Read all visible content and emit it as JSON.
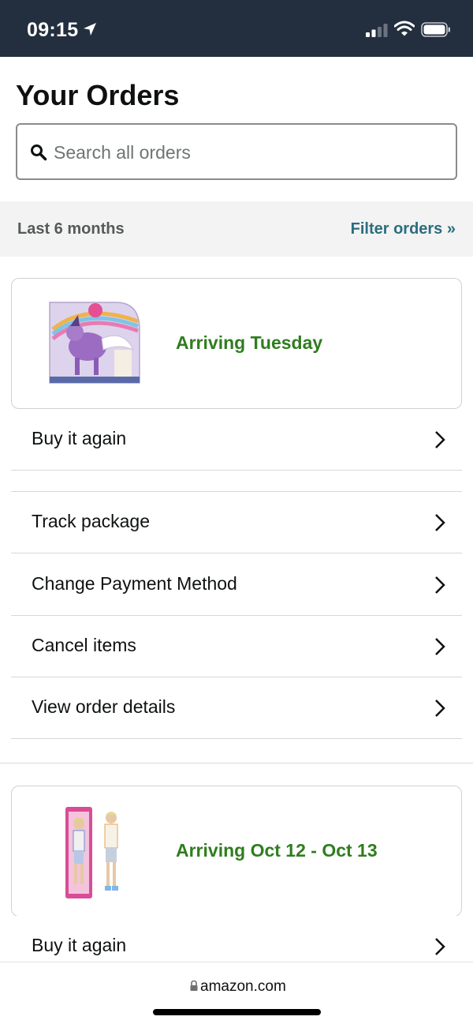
{
  "status_bar": {
    "time": "09:15",
    "icons": [
      "location-arrow-icon",
      "cellular-signal-icon",
      "wifi-icon",
      "battery-icon"
    ]
  },
  "page": {
    "title": "Your Orders"
  },
  "search": {
    "placeholder": "Search all orders",
    "value": "",
    "icon": "search-icon"
  },
  "filter": {
    "range_label": "Last 6 months",
    "filter_link": "Filter orders »"
  },
  "orders": [
    {
      "status": "Arriving Tuesday",
      "status_color": "#2f7d1f",
      "actions": [
        "Buy it again",
        "Track package",
        "Change Payment Method",
        "Cancel items",
        "View order details"
      ]
    },
    {
      "status": "Arriving Oct 12 - Oct 13",
      "status_color": "#2f7d1f",
      "actions": [
        "Buy it again"
      ]
    }
  ],
  "footer": {
    "url": "amazon.com"
  },
  "colors": {
    "header_bg": "#232f3e",
    "status_green": "#2f7d1f",
    "link_teal": "#2b6d80"
  }
}
